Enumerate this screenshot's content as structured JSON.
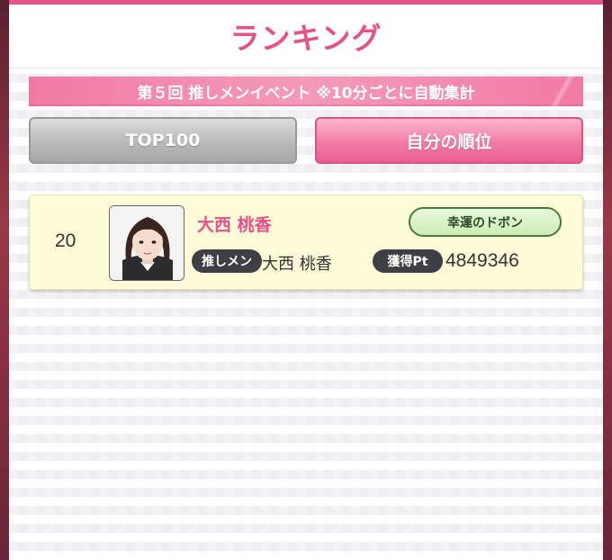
{
  "header": {
    "title": "ランキング"
  },
  "event": {
    "banner_text": "第５回 推しメンイベント ※10分ごとに自動集計"
  },
  "tabs": [
    {
      "label": "TOP100",
      "selected": false
    },
    {
      "label": "自分の順位",
      "selected": true
    }
  ],
  "entry": {
    "rank": "20",
    "avatar_icon": "member-photo",
    "name": "大西 桃香",
    "badge": "幸運のドボン",
    "oshi_label": "推しメン",
    "oshi_value": "大西 桃香",
    "points_label": "獲得Pt",
    "points_value": "4849346"
  },
  "colors": {
    "accent_pink": "#e8508a",
    "banner_pink": "#f27aa6",
    "entry_bg": "#fefbd8",
    "badge_green": "#cdeeb8"
  }
}
